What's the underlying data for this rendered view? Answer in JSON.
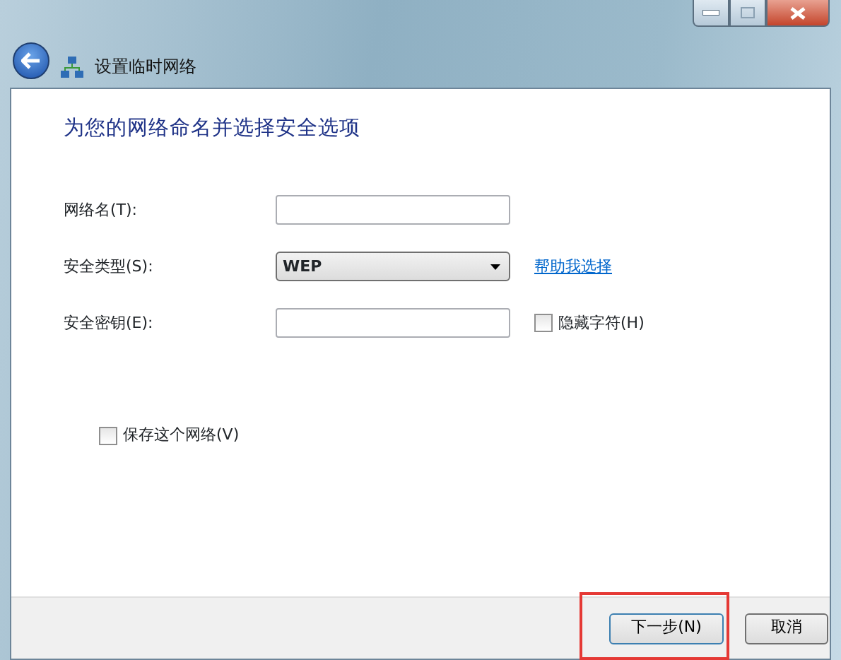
{
  "window": {
    "title": "设置临时网络"
  },
  "heading": "为您的网络命名并选择安全选项",
  "fields": [
    {
      "kind": "text",
      "label": "网络名(T):"
    },
    {
      "kind": "select",
      "label": "安全类型(S):",
      "value": "WEP",
      "link": "帮助我选择"
    },
    {
      "kind": "password",
      "label": "安全密钥(E):",
      "option": {
        "label": "隐藏字符(H)",
        "checked": false
      }
    }
  ],
  "save_network": {
    "label": "保存这个网络(V)",
    "checked": false
  },
  "buttons": [
    {
      "label": "下一步(N)",
      "highlighted": true
    },
    {
      "label": "取消",
      "highlighted": false
    }
  ]
}
